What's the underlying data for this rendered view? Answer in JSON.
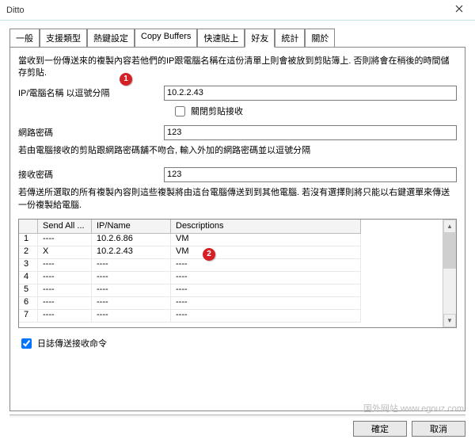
{
  "window": {
    "title": "Ditto"
  },
  "tabs": {
    "items": [
      {
        "label": "一般"
      },
      {
        "label": "支援類型"
      },
      {
        "label": "熱鍵設定"
      },
      {
        "label": "Copy Buffers"
      },
      {
        "label": "快速貼上"
      },
      {
        "label": "好友"
      },
      {
        "label": "統計"
      },
      {
        "label": "關於"
      }
    ],
    "active_index": 5
  },
  "panel": {
    "intro": "當收到一份傳送來的複製內容若他們的IP跟電腦名稱在這份清單上則會被放到剪貼簿上. 否則將會在稍後的時間儲存剪貼.",
    "ip_label": "IP/電腦名稱 以逗號分隔",
    "ip_value": "10.2.2.43",
    "close_receive_label": "關閉剪貼接收",
    "close_receive_checked": false,
    "net_pwd_label": "網路密碼",
    "net_pwd_value": "123",
    "net_pwd_note": "若由電腦接收的剪貼跟網路密碼舖不吻合, 輸入外加的網路密碼並以逗號分隔",
    "recv_pwd_label": "接收密碼",
    "recv_pwd_value": "123",
    "send_note": "若傳送所選取的所有複製內容則這些複製將由這台電腦傳送到到其他電腦. 若沒有選擇則將只能以右鍵選單來傳送一份複製給電腦.",
    "grid": {
      "headers": {
        "send": "Send All ...",
        "ip": "IP/Name",
        "desc": "Descriptions"
      },
      "rows": [
        {
          "idx": "1",
          "send": "----",
          "ip": "10.2.6.86",
          "desc": "VM"
        },
        {
          "idx": "2",
          "send": "X",
          "ip": "10.2.2.43",
          "desc": "VM"
        },
        {
          "idx": "3",
          "send": "----",
          "ip": "----",
          "desc": "----"
        },
        {
          "idx": "4",
          "send": "----",
          "ip": "----",
          "desc": "----"
        },
        {
          "idx": "5",
          "send": "----",
          "ip": "----",
          "desc": "----"
        },
        {
          "idx": "6",
          "send": "----",
          "ip": "----",
          "desc": "----"
        },
        {
          "idx": "7",
          "send": "----",
          "ip": "----",
          "desc": "----"
        }
      ]
    },
    "log_label": "日誌傳送接收命令",
    "log_checked": true
  },
  "annotations": {
    "badge1": "1",
    "badge2": "2"
  },
  "buttons": {
    "ok": "確定",
    "cancel": "取消"
  },
  "watermark": "国外网站   www.egouz.com"
}
